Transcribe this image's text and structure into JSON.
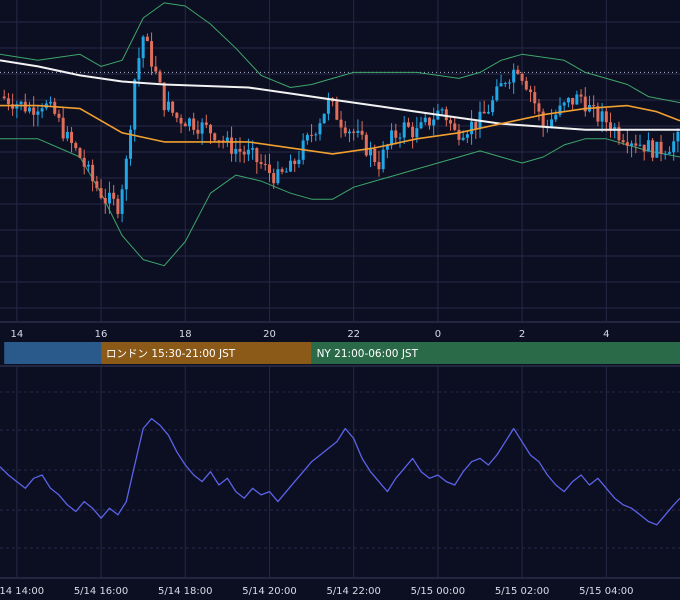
{
  "colors": {
    "background": "#0c0e22",
    "grid": "#262a45",
    "candle_up": "#22a7e6",
    "candle_down": "#e06e5a",
    "ma_long": "#f2f2f2",
    "ma_short": "#f0a030",
    "bollinger": "#3da76a",
    "oscillator": "#5b63e8",
    "tokyo_band": "#2a5a8c",
    "london_band": "#8c5a18",
    "ny_band": "#2a6a48"
  },
  "sessions": [
    {
      "label": "",
      "start": 13.7,
      "end": 16.0,
      "color": "#2a5a8c"
    },
    {
      "label": "ロンドン 15:30-21:00 JST",
      "start": 16.0,
      "end": 21.0,
      "color": "#8c5a18"
    },
    {
      "label": "NY 21:00-06:00 JST",
      "start": 21.0,
      "end": 29.75,
      "color": "#2a6a48"
    }
  ],
  "chart_data": [
    {
      "type": "candlestick",
      "x_ticks": [
        "14",
        "16",
        "18",
        "20",
        "22",
        "0",
        "2",
        "4"
      ],
      "x_tick_hours": [
        14,
        16,
        18,
        20,
        22,
        24,
        26,
        28
      ],
      "xlim": [
        13.6,
        29.75
      ],
      "ylim": [
        0,
        100
      ],
      "reference_line": 80,
      "series": [
        {
          "kind": "close",
          "points": [
            [
              13.6,
              72
            ],
            [
              14.0,
              70
            ],
            [
              14.3,
              68
            ],
            [
              14.6,
              70
            ],
            [
              14.9,
              66
            ],
            [
              15.2,
              58
            ],
            [
              15.5,
              52
            ],
            [
              15.8,
              44
            ],
            [
              16.1,
              38
            ],
            [
              16.4,
              36
            ],
            [
              16.6,
              50
            ],
            [
              16.8,
              78
            ],
            [
              17.0,
              92
            ],
            [
              17.2,
              84
            ],
            [
              17.5,
              70
            ],
            [
              17.8,
              65
            ],
            [
              18.1,
              64
            ],
            [
              18.4,
              62
            ],
            [
              18.7,
              60
            ],
            [
              19.0,
              56
            ],
            [
              19.3,
              54
            ],
            [
              19.6,
              52
            ],
            [
              19.9,
              48
            ],
            [
              20.2,
              45
            ],
            [
              20.5,
              48
            ],
            [
              20.8,
              55
            ],
            [
              21.1,
              62
            ],
            [
              21.4,
              70
            ],
            [
              21.7,
              64
            ],
            [
              22.0,
              60
            ],
            [
              22.3,
              55
            ],
            [
              22.6,
              50
            ],
            [
              22.9,
              58
            ],
            [
              23.2,
              62
            ],
            [
              23.5,
              60
            ],
            [
              23.8,
              64
            ],
            [
              24.1,
              68
            ],
            [
              24.4,
              60
            ],
            [
              24.7,
              62
            ],
            [
              25.0,
              64
            ],
            [
              25.3,
              70
            ],
            [
              25.6,
              78
            ],
            [
              25.9,
              82
            ],
            [
              26.2,
              74
            ],
            [
              26.5,
              62
            ],
            [
              26.8,
              66
            ],
            [
              27.1,
              70
            ],
            [
              27.4,
              72
            ],
            [
              27.7,
              66
            ],
            [
              28.0,
              64
            ],
            [
              28.3,
              60
            ],
            [
              28.6,
              58
            ],
            [
              28.9,
              56
            ],
            [
              29.2,
              54
            ],
            [
              29.5,
              56
            ],
            [
              29.75,
              58
            ]
          ]
        },
        {
          "kind": "ma_long",
          "points": [
            [
              13.6,
              84
            ],
            [
              14.5,
              82
            ],
            [
              15.5,
              79
            ],
            [
              16.5,
              77
            ],
            [
              17.5,
              76
            ],
            [
              18.5,
              75.5
            ],
            [
              19.5,
              75
            ],
            [
              20.5,
              73
            ],
            [
              21.5,
              71
            ],
            [
              22.5,
              69
            ],
            [
              23.5,
              67
            ],
            [
              24.5,
              65
            ],
            [
              25.5,
              63
            ],
            [
              26.5,
              62
            ],
            [
              27.5,
              61
            ],
            [
              28.5,
              61
            ],
            [
              29.75,
              61
            ]
          ]
        },
        {
          "kind": "ma_short",
          "points": [
            [
              13.6,
              69
            ],
            [
              14.5,
              69
            ],
            [
              15.5,
              68
            ],
            [
              16.5,
              60
            ],
            [
              17.5,
              57
            ],
            [
              18.5,
              57
            ],
            [
              19.5,
              57
            ],
            [
              20.5,
              55
            ],
            [
              21.5,
              53
            ],
            [
              22.5,
              55
            ],
            [
              23.5,
              58
            ],
            [
              24.5,
              60
            ],
            [
              25.5,
              63
            ],
            [
              26.5,
              66
            ],
            [
              27.5,
              68
            ],
            [
              28.5,
              69
            ],
            [
              29.2,
              67
            ],
            [
              29.75,
              64
            ]
          ]
        },
        {
          "kind": "bollinger_upper",
          "points": [
            [
              13.6,
              86
            ],
            [
              14.5,
              84
            ],
            [
              15.5,
              86
            ],
            [
              16.0,
              82
            ],
            [
              16.5,
              84
            ],
            [
              17.0,
              98
            ],
            [
              17.5,
              103
            ],
            [
              18.0,
              102
            ],
            [
              18.6,
              96
            ],
            [
              19.2,
              88
            ],
            [
              19.8,
              79
            ],
            [
              20.5,
              75
            ],
            [
              21.0,
              76
            ],
            [
              21.5,
              78
            ],
            [
              22.0,
              80
            ],
            [
              22.5,
              80
            ],
            [
              23.0,
              80
            ],
            [
              23.5,
              80
            ],
            [
              24.0,
              79
            ],
            [
              24.5,
              78
            ],
            [
              25.0,
              80
            ],
            [
              25.5,
              84
            ],
            [
              26.0,
              86
            ],
            [
              26.5,
              85
            ],
            [
              27.0,
              84
            ],
            [
              27.5,
              80
            ],
            [
              28.0,
              78
            ],
            [
              28.5,
              76
            ],
            [
              29.0,
              72
            ],
            [
              29.75,
              70
            ]
          ]
        },
        {
          "kind": "bollinger_lower",
          "points": [
            [
              13.6,
              58
            ],
            [
              14.5,
              58
            ],
            [
              15.5,
              52
            ],
            [
              16.0,
              40
            ],
            [
              16.5,
              26
            ],
            [
              17.0,
              18
            ],
            [
              17.5,
              16
            ],
            [
              18.0,
              24
            ],
            [
              18.6,
              40
            ],
            [
              19.2,
              46
            ],
            [
              19.8,
              44
            ],
            [
              20.5,
              40
            ],
            [
              21.0,
              38
            ],
            [
              21.5,
              38
            ],
            [
              22.0,
              42
            ],
            [
              22.5,
              44
            ],
            [
              23.0,
              46
            ],
            [
              23.5,
              48
            ],
            [
              24.0,
              50
            ],
            [
              24.5,
              52
            ],
            [
              25.0,
              54
            ],
            [
              25.5,
              52
            ],
            [
              26.0,
              50
            ],
            [
              26.5,
              52
            ],
            [
              27.0,
              56
            ],
            [
              27.5,
              58
            ],
            [
              28.0,
              58
            ],
            [
              28.5,
              56
            ],
            [
              29.0,
              54
            ],
            [
              29.75,
              52
            ]
          ]
        }
      ]
    },
    {
      "type": "line",
      "x_ticks": [
        "5/14 14:00",
        "5/14 16:00",
        "5/14 18:00",
        "5/14 20:00",
        "5/14 22:00",
        "5/15 00:00",
        "5/15 02:00",
        "5/15 04:00"
      ],
      "x_tick_hours": [
        14,
        16,
        18,
        20,
        22,
        24,
        26,
        28
      ],
      "xlim": [
        13.6,
        29.75
      ],
      "ylim": [
        0,
        100
      ],
      "series": [
        {
          "name": "",
          "points": [
            [
              13.6,
              55
            ],
            [
              13.8,
              50
            ],
            [
              14.0,
              46
            ],
            [
              14.2,
              42
            ],
            [
              14.4,
              48
            ],
            [
              14.6,
              50
            ],
            [
              14.8,
              42
            ],
            [
              15.0,
              38
            ],
            [
              15.2,
              32
            ],
            [
              15.4,
              28
            ],
            [
              15.6,
              34
            ],
            [
              15.8,
              30
            ],
            [
              16.0,
              24
            ],
            [
              16.2,
              30
            ],
            [
              16.4,
              26
            ],
            [
              16.6,
              34
            ],
            [
              16.8,
              56
            ],
            [
              17.0,
              78
            ],
            [
              17.2,
              84
            ],
            [
              17.4,
              80
            ],
            [
              17.6,
              74
            ],
            [
              17.8,
              64
            ],
            [
              18.0,
              56
            ],
            [
              18.2,
              50
            ],
            [
              18.4,
              46
            ],
            [
              18.6,
              52
            ],
            [
              18.8,
              44
            ],
            [
              19.0,
              48
            ],
            [
              19.2,
              40
            ],
            [
              19.4,
              36
            ],
            [
              19.6,
              42
            ],
            [
              19.8,
              38
            ],
            [
              20.0,
              40
            ],
            [
              20.2,
              34
            ],
            [
              20.4,
              40
            ],
            [
              20.6,
              46
            ],
            [
              20.8,
              52
            ],
            [
              21.0,
              58
            ],
            [
              21.2,
              62
            ],
            [
              21.4,
              66
            ],
            [
              21.6,
              70
            ],
            [
              21.8,
              78
            ],
            [
              22.0,
              72
            ],
            [
              22.2,
              60
            ],
            [
              22.4,
              52
            ],
            [
              22.6,
              46
            ],
            [
              22.8,
              40
            ],
            [
              23.0,
              48
            ],
            [
              23.2,
              54
            ],
            [
              23.4,
              60
            ],
            [
              23.6,
              52
            ],
            [
              23.8,
              48
            ],
            [
              24.0,
              50
            ],
            [
              24.2,
              46
            ],
            [
              24.4,
              44
            ],
            [
              24.6,
              52
            ],
            [
              24.8,
              58
            ],
            [
              25.0,
              60
            ],
            [
              25.2,
              56
            ],
            [
              25.4,
              62
            ],
            [
              25.6,
              70
            ],
            [
              25.8,
              78
            ],
            [
              26.0,
              70
            ],
            [
              26.2,
              62
            ],
            [
              26.4,
              58
            ],
            [
              26.6,
              50
            ],
            [
              26.8,
              44
            ],
            [
              27.0,
              40
            ],
            [
              27.2,
              46
            ],
            [
              27.4,
              50
            ],
            [
              27.6,
              44
            ],
            [
              27.8,
              48
            ],
            [
              28.0,
              42
            ],
            [
              28.2,
              36
            ],
            [
              28.4,
              32
            ],
            [
              28.6,
              30
            ],
            [
              28.8,
              26
            ],
            [
              29.0,
              22
            ],
            [
              29.2,
              20
            ],
            [
              29.4,
              26
            ],
            [
              29.6,
              32
            ],
            [
              29.75,
              36
            ]
          ]
        }
      ]
    }
  ]
}
